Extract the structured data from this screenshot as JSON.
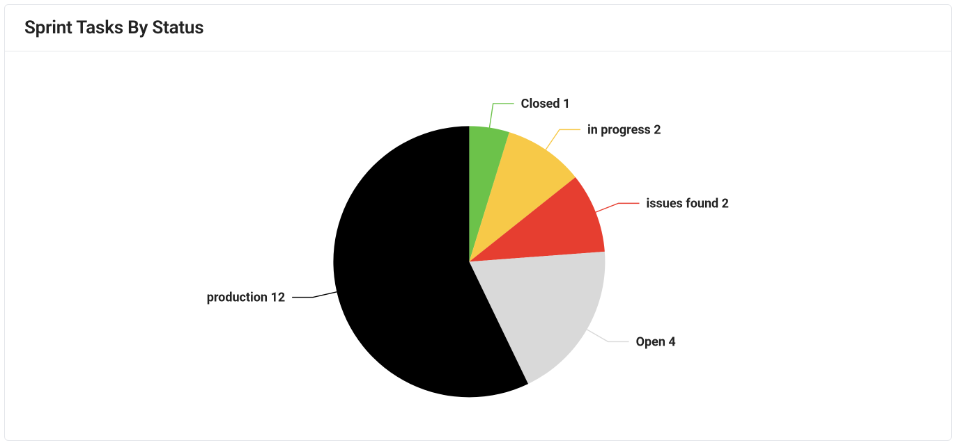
{
  "card": {
    "title": "Sprint Tasks By Status"
  },
  "chart_data": {
    "type": "pie",
    "title": "Sprint Tasks By Status",
    "series": [
      {
        "name": "Closed",
        "value": 1,
        "color": "#6cc24a"
      },
      {
        "name": "in progress",
        "value": 2,
        "color": "#f7c948"
      },
      {
        "name": "issues found",
        "value": 2,
        "color": "#e63e30"
      },
      {
        "name": "Open",
        "value": 4,
        "color": "#d9d9d9"
      },
      {
        "name": "production",
        "value": 12,
        "color": "#000000"
      }
    ]
  }
}
